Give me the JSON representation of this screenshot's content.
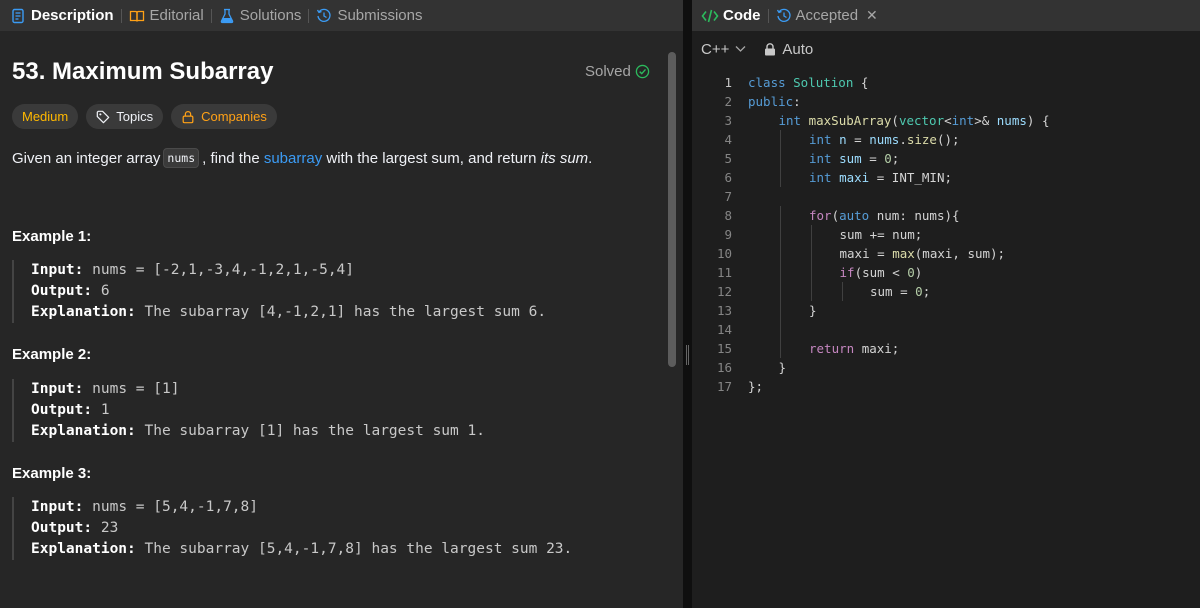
{
  "left_tabs": [
    {
      "label": "Description",
      "icon": "description-icon",
      "active": true
    },
    {
      "label": "Editorial",
      "icon": "book-icon",
      "active": false
    },
    {
      "label": "Solutions",
      "icon": "flask-icon",
      "active": false
    },
    {
      "label": "Submissions",
      "icon": "history-icon",
      "active": false
    }
  ],
  "problem": {
    "title": "53. Maximum Subarray",
    "status": "Solved",
    "difficulty": "Medium",
    "topics_label": "Topics",
    "companies_label": "Companies",
    "desc_part1": "Given an integer array",
    "desc_code": "nums",
    "desc_part2": ", find the",
    "desc_link": "subarray",
    "desc_part3": "with the largest sum, and return",
    "desc_italic": "its sum",
    "desc_end": "."
  },
  "examples": [
    {
      "title": "Example 1:",
      "input_label": "Input:",
      "input": "nums = [-2,1,-3,4,-1,2,1,-5,4]",
      "output_label": "Output:",
      "output": "6",
      "explanation_label": "Explanation:",
      "explanation": "The subarray [4,-1,2,1] has the largest sum 6."
    },
    {
      "title": "Example 2:",
      "input_label": "Input:",
      "input": "nums = [1]",
      "output_label": "Output:",
      "output": "1",
      "explanation_label": "Explanation:",
      "explanation": "The subarray [1] has the largest sum 1."
    },
    {
      "title": "Example 3:",
      "input_label": "Input:",
      "input": "nums = [5,4,-1,7,8]",
      "output_label": "Output:",
      "output": "23",
      "explanation_label": "Explanation:",
      "explanation": "The subarray [5,4,-1,7,8] has the largest sum 23."
    }
  ],
  "right_tabs": [
    {
      "label": "Code",
      "icon": "code-icon",
      "active": true
    },
    {
      "label": "Accepted",
      "icon": "history-icon",
      "active": false,
      "closable": true
    }
  ],
  "editor_toolbar": {
    "language": "C++",
    "mode": "Auto"
  },
  "colors": {
    "accent_green": "#2cbb5d",
    "medium": "#ffb800",
    "link": "#3b9bf4"
  },
  "code": {
    "line_numbers": [
      "1",
      "2",
      "3",
      "4",
      "5",
      "6",
      "7",
      "8",
      "9",
      "10",
      "11",
      "12",
      "13",
      "14",
      "15",
      "16",
      "17"
    ],
    "lines": [
      [
        {
          "t": "kw",
          "v": "class "
        },
        {
          "t": "ty",
          "v": "Solution"
        },
        {
          "t": "pl",
          "v": " {"
        }
      ],
      [
        {
          "t": "kw",
          "v": "public"
        },
        {
          "t": "pl",
          "v": ":"
        }
      ],
      [
        {
          "t": "kw",
          "v": "int "
        },
        {
          "t": "fn",
          "v": "maxSubArray"
        },
        {
          "t": "pl",
          "v": "("
        },
        {
          "t": "ty",
          "v": "vector"
        },
        {
          "t": "pl",
          "v": "<"
        },
        {
          "t": "kw",
          "v": "int"
        },
        {
          "t": "pl",
          "v": ">& "
        },
        {
          "t": "vr",
          "v": "nums"
        },
        {
          "t": "pl",
          "v": ") {"
        }
      ],
      [
        {
          "t": "kw",
          "v": "int "
        },
        {
          "t": "vr",
          "v": "n"
        },
        {
          "t": "pl",
          "v": " = "
        },
        {
          "t": "vr",
          "v": "nums"
        },
        {
          "t": "pl",
          "v": "."
        },
        {
          "t": "fn",
          "v": "size"
        },
        {
          "t": "pl",
          "v": "();"
        }
      ],
      [
        {
          "t": "kw",
          "v": "int "
        },
        {
          "t": "vr",
          "v": "sum"
        },
        {
          "t": "pl",
          "v": " = "
        },
        {
          "t": "nm",
          "v": "0"
        },
        {
          "t": "pl",
          "v": ";"
        }
      ],
      [
        {
          "t": "kw",
          "v": "int "
        },
        {
          "t": "vr",
          "v": "maxi"
        },
        {
          "t": "pl",
          "v": " = INT_MIN;"
        }
      ],
      [],
      [
        {
          "t": "ctl",
          "v": "for"
        },
        {
          "t": "pl",
          "v": "("
        },
        {
          "t": "kw",
          "v": "auto "
        },
        {
          "t": "pl",
          "v": "num: nums){"
        }
      ],
      [
        {
          "t": "pl",
          "v": "sum += num;"
        }
      ],
      [
        {
          "t": "pl",
          "v": "maxi = "
        },
        {
          "t": "fn",
          "v": "max"
        },
        {
          "t": "pl",
          "v": "(maxi, sum);"
        }
      ],
      [
        {
          "t": "ctl",
          "v": "if"
        },
        {
          "t": "pl",
          "v": "(sum < "
        },
        {
          "t": "nm",
          "v": "0"
        },
        {
          "t": "pl",
          "v": ")"
        }
      ],
      [
        {
          "t": "pl",
          "v": "sum = "
        },
        {
          "t": "nm",
          "v": "0"
        },
        {
          "t": "pl",
          "v": ";"
        }
      ],
      [
        {
          "t": "pl",
          "v": "}"
        }
      ],
      [],
      [
        {
          "t": "ctl",
          "v": "return "
        },
        {
          "t": "pl",
          "v": "maxi;"
        }
      ],
      [
        {
          "t": "pl",
          "v": "}"
        }
      ],
      [
        {
          "t": "pl",
          "v": "};"
        }
      ]
    ]
  }
}
